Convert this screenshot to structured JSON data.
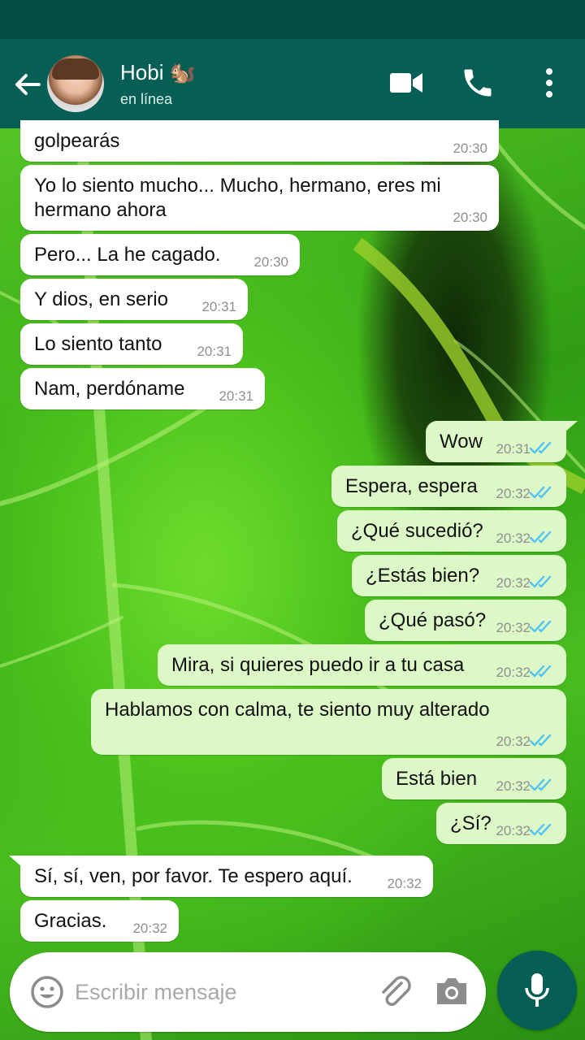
{
  "header": {
    "contact_name": "Hobi 🐿️",
    "contact_status": "en línea"
  },
  "messages": [
    {
      "dir": "in",
      "text": "golpearás",
      "time": "20:30"
    },
    {
      "dir": "in",
      "text": "Yo lo siento mucho... Mucho, hermano, eres mi hermano ahora",
      "time": "20:30"
    },
    {
      "dir": "in",
      "text": "Pero... La he cagado.",
      "time": "20:30"
    },
    {
      "dir": "in",
      "text": "Y dios, en serio",
      "time": "20:31"
    },
    {
      "dir": "in",
      "text": "Lo siento tanto",
      "time": "20:31"
    },
    {
      "dir": "in",
      "text": "Nam, perdóname",
      "time": "20:31"
    },
    {
      "dir": "out",
      "text": "Wow",
      "time": "20:31",
      "status": "read"
    },
    {
      "dir": "out",
      "text": "Espera, espera",
      "time": "20:32",
      "status": "read"
    },
    {
      "dir": "out",
      "text": "¿Qué sucedió?",
      "time": "20:32",
      "status": "read"
    },
    {
      "dir": "out",
      "text": "¿Estás bien?",
      "time": "20:32",
      "status": "read"
    },
    {
      "dir": "out",
      "text": "¿Qué pasó?",
      "time": "20:32",
      "status": "read"
    },
    {
      "dir": "out",
      "text": "Mira, si quieres puedo ir a tu casa",
      "time": "20:32",
      "status": "read"
    },
    {
      "dir": "out",
      "text": "Hablamos con calma, te siento muy alterado",
      "time": "20:32",
      "status": "read"
    },
    {
      "dir": "out",
      "text": "Está bien",
      "time": "20:32",
      "status": "read"
    },
    {
      "dir": "out",
      "text": "¿Sí?",
      "time": "20:32",
      "status": "read"
    },
    {
      "dir": "in",
      "text": "Sí, sí, ven, por favor. Te espero aquí.",
      "time": "20:32"
    },
    {
      "dir": "in",
      "text": "Gracias.",
      "time": "20:32"
    }
  ],
  "composer": {
    "placeholder": "Escribir mensaje"
  },
  "icons": {
    "back": "arrow-left-icon",
    "video": "video-camera-icon",
    "call": "phone-icon",
    "menu": "more-vert-icon",
    "emoji": "emoji-icon",
    "attach": "paperclip-icon",
    "camera": "camera-icon",
    "mic": "microphone-icon",
    "read_receipt": "double-check-icon"
  },
  "colors": {
    "app_bar": "#075e54",
    "status_bar": "#054d44",
    "outgoing_bubble": "#dcf8c6",
    "incoming_bubble": "#ffffff",
    "read_tick": "#4fc3f7"
  }
}
